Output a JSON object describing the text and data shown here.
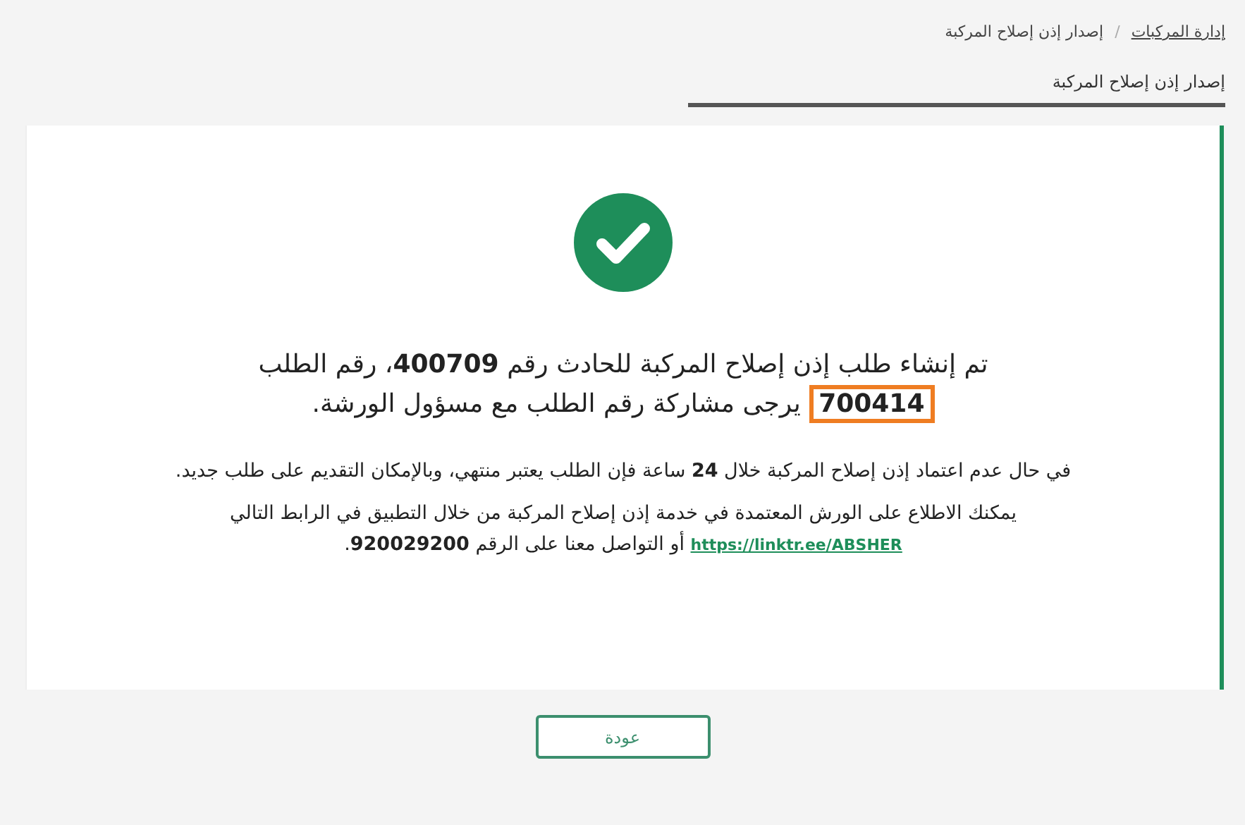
{
  "breadcrumb": [
    {
      "label": "إدارة المركبات",
      "link": true
    },
    {
      "label": "إصدار إذن إصلاح المركبة",
      "link": false
    }
  ],
  "breadcrumb_separator": "/",
  "page_title": "إصدار إذن إصلاح المركبة",
  "success": {
    "kind": "success",
    "message": "تم إنشاء طلب إذن إصلاح المركبة للحادث رقم **400709**، رقم الطلب **700414** يرجى مشاركة رقم الطلب مع مسؤول الورشة.",
    "request_number_highlighted": true,
    "note": "في حال عدم اعتماد إذن إصلاح المركبة خلال **24** ساعة فإن الطلب يعتبر منتهي، وبالإمكان التقديم على طلب جديد.",
    "info_before_link": "يمكنك الاطلاع على الورش المعتمدة في خدمة إذن إصلاح المركبة من خلال التطبيق في الرابط التالي",
    "link": "https://linktr.ee/ABSHER",
    "info_after_link": "أو التواصل معنا على الرقم **920029200**."
  },
  "buttons": [
    {
      "label": "عودة",
      "kind": "outline"
    }
  ]
}
